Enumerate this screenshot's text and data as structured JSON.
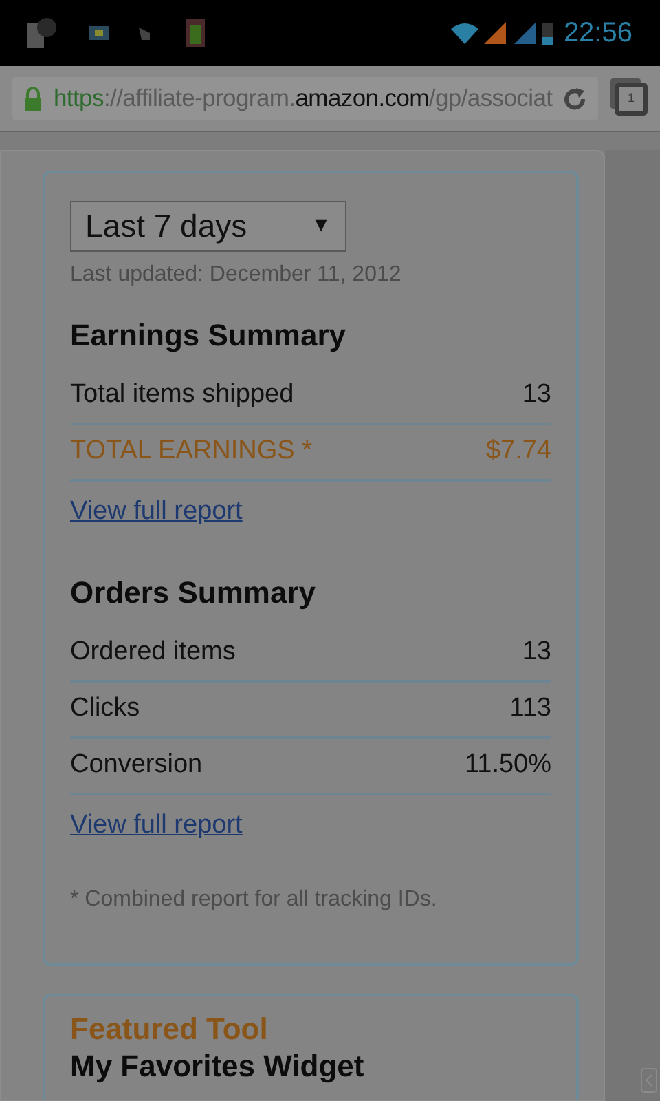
{
  "status_bar": {
    "time": "22:56"
  },
  "address_bar": {
    "url_parts": [
      {
        "kind": "scheme",
        "text": "https"
      },
      {
        "kind": "rest",
        "text": "://affiliate-program."
      },
      {
        "kind": "domain",
        "text": "amazon.com"
      },
      {
        "kind": "rest",
        "text": "/gp/associat"
      }
    ],
    "tab_count": "1"
  },
  "report": {
    "period": {
      "value": "Last 7 days",
      "arrow": "▼"
    },
    "last_updated": "Last updated: December 11, 2012",
    "earnings": {
      "title": "Earnings Summary",
      "rows": [
        {
          "kind": "normal",
          "label": "Total items shipped",
          "value": "13"
        },
        {
          "kind": "highlight",
          "label": "TOTAL EARNINGS *",
          "value": "$7.74"
        }
      ],
      "link": "View full report"
    },
    "orders": {
      "title": "Orders Summary",
      "rows": [
        {
          "kind": "normal",
          "label": "Ordered items",
          "value": "13"
        },
        {
          "kind": "normal",
          "label": "Clicks",
          "value": "113"
        },
        {
          "kind": "normal",
          "label": "Conversion",
          "value": "11.50%"
        }
      ],
      "link": "View full report"
    },
    "footnote": "* Combined report for all tracking IDs."
  },
  "featured": {
    "label": "Featured Tool",
    "title": "My Favorites Widget"
  }
}
